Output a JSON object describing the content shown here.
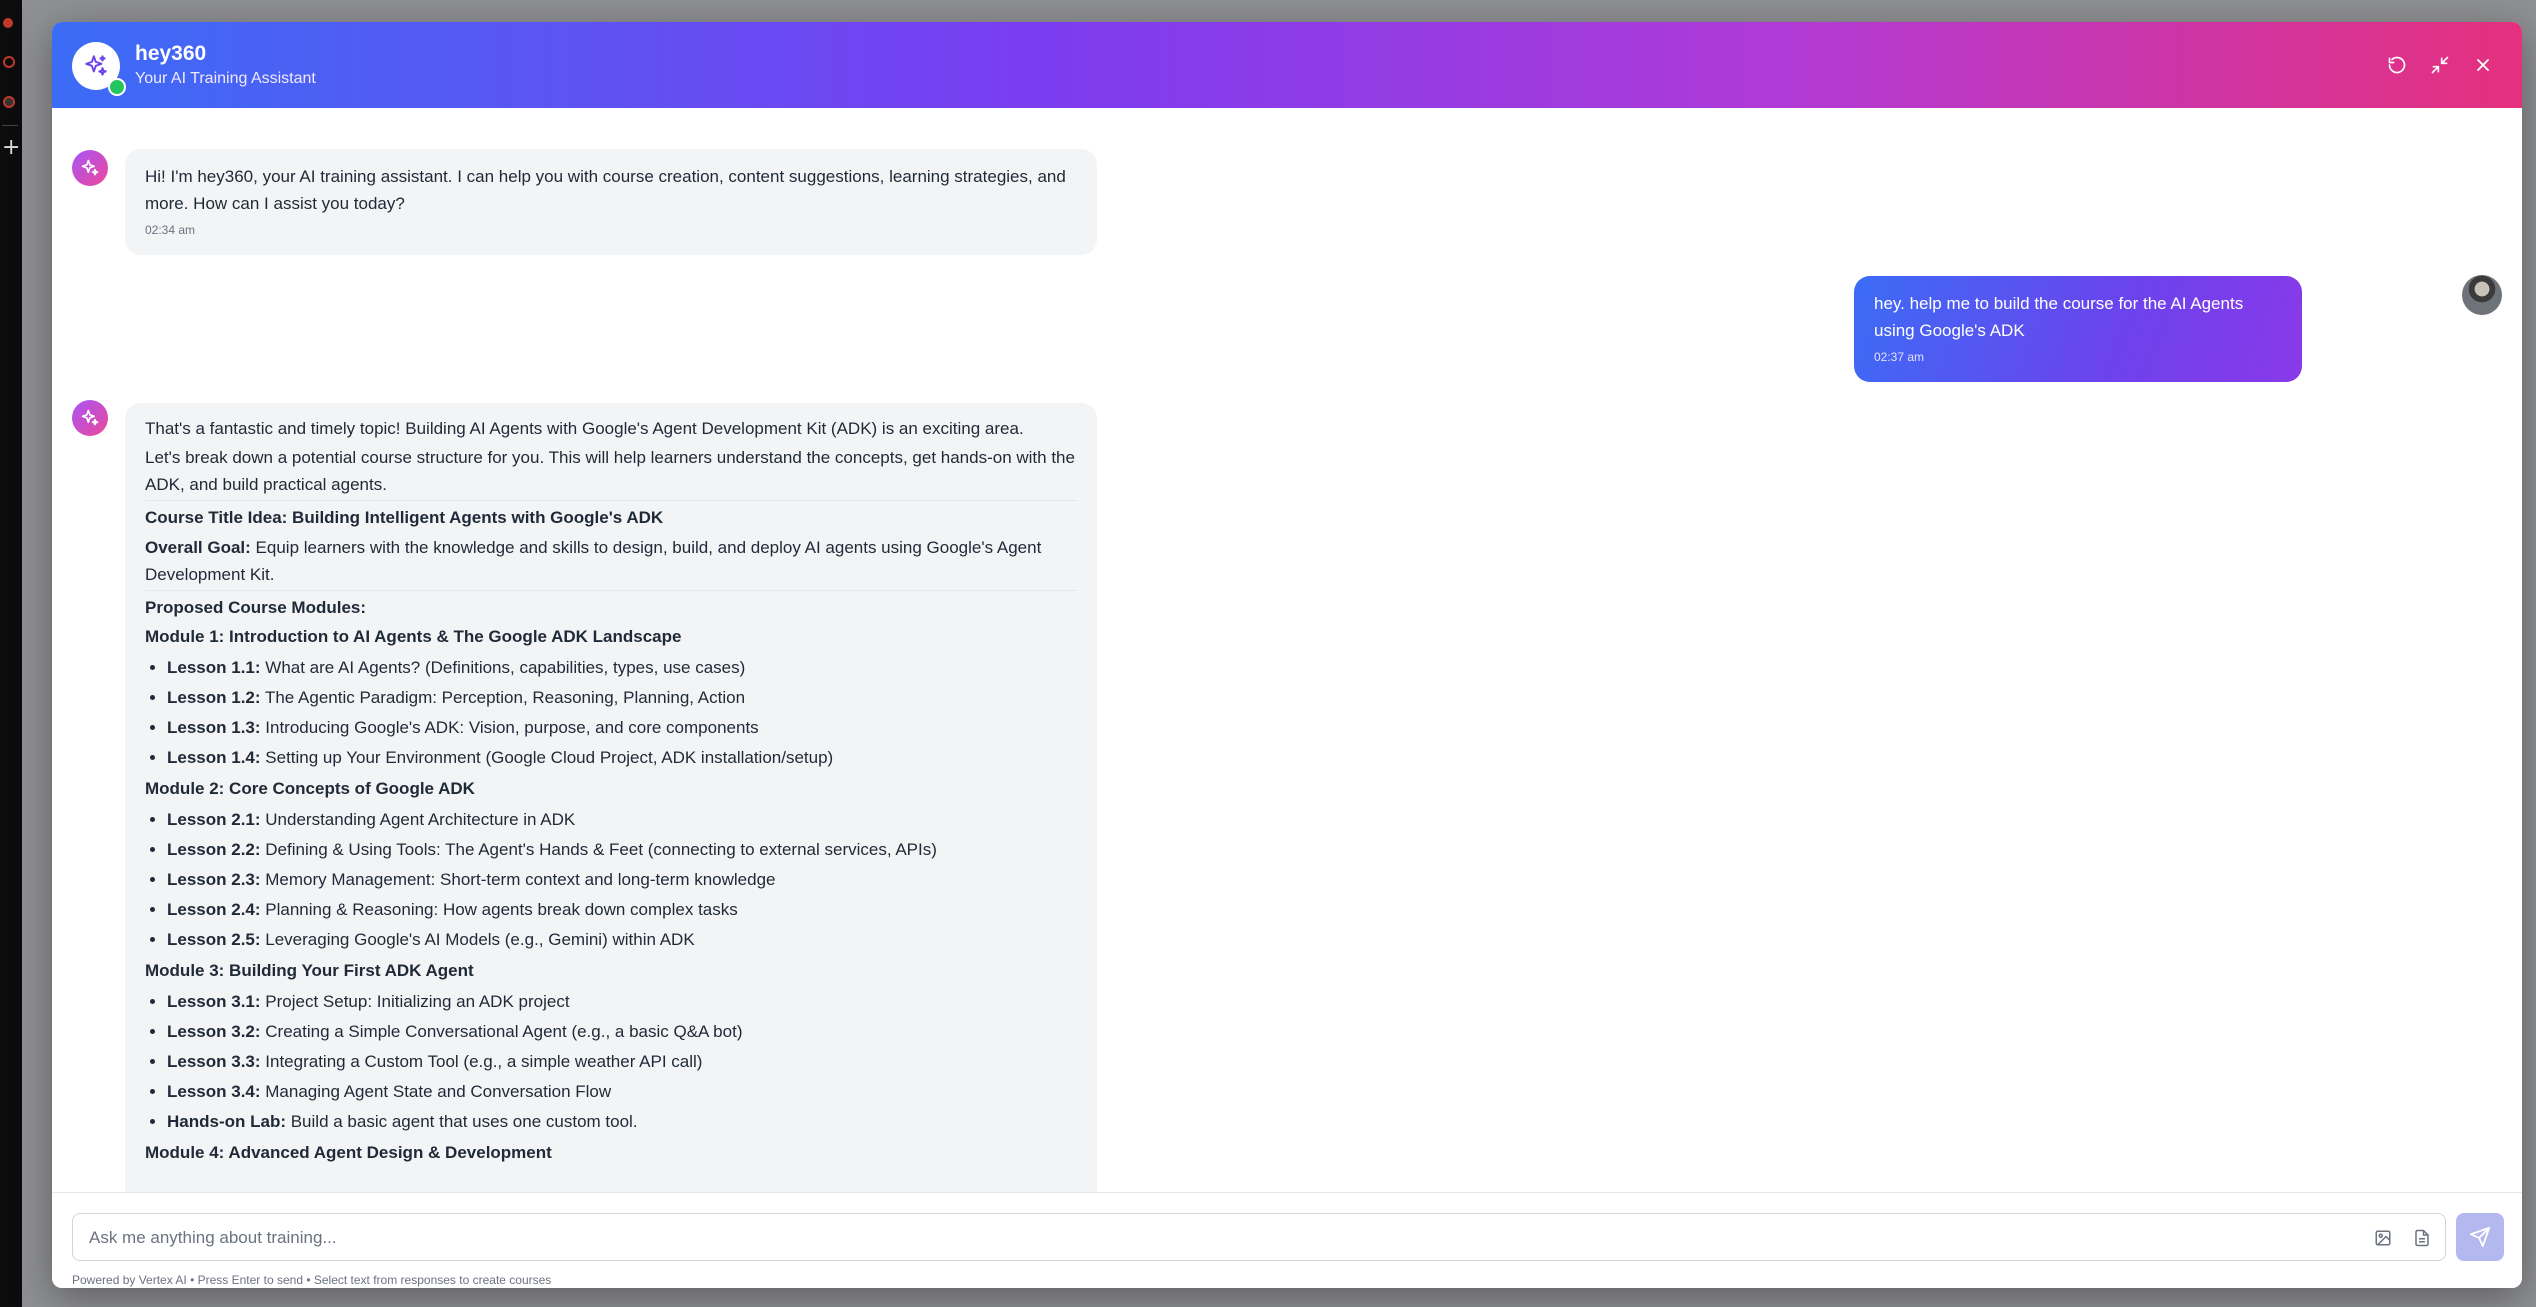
{
  "app": {
    "title": "hey360",
    "subtitle": "Your AI Training Assistant"
  },
  "colors": {
    "header_start": "#3b6cf6",
    "header_mid": "#7b3df0",
    "header_end": "#e5307d",
    "online": "#22c55e",
    "bot_bubble": "#f3f4f6"
  },
  "header_icons": [
    "refresh-icon",
    "minimize-icon",
    "close-icon"
  ],
  "messages": {
    "bot_greeting": {
      "text": "Hi! I'm hey360, your AI training assistant. I can help you with course creation, content suggestions, learning strategies, and more. How can I assist you today?",
      "time": "02:34 am"
    },
    "user_request": {
      "text": "hey. help me to build the course for the AI Agents using Google's ADK",
      "time": "02:37 am"
    },
    "bot_course": {
      "intro1": "That's a fantastic and timely topic! Building AI Agents with Google's Agent Development Kit (ADK) is an exciting area.",
      "intro2": "Let's break down a potential course structure for you. This will help learners understand the concepts, get hands-on with the ADK, and build practical agents.",
      "title_line": "Course Title Idea: Building Intelligent Agents with Google's ADK",
      "goal_label": "Overall Goal:",
      "goal_text": " Equip learners with the knowledge and skills to design, build, and deploy AI agents using Google's Agent Development Kit.",
      "modules_heading": "Proposed Course Modules:",
      "modules": [
        {
          "title": "Module 1: Introduction to AI Agents & The Google ADK Landscape",
          "lessons": [
            {
              "label": "Lesson 1.1:",
              "text": " What are AI Agents? (Definitions, capabilities, types, use cases)"
            },
            {
              "label": "Lesson 1.2:",
              "text": " The Agentic Paradigm: Perception, Reasoning, Planning, Action"
            },
            {
              "label": "Lesson 1.3:",
              "text": " Introducing Google's ADK: Vision, purpose, and core components"
            },
            {
              "label": "Lesson 1.4:",
              "text": " Setting up Your Environment (Google Cloud Project, ADK installation/setup)"
            }
          ]
        },
        {
          "title": "Module 2: Core Concepts of Google ADK",
          "lessons": [
            {
              "label": "Lesson 2.1:",
              "text": " Understanding Agent Architecture in ADK"
            },
            {
              "label": "Lesson 2.2:",
              "text": " Defining & Using Tools: The Agent's Hands & Feet (connecting to external services, APIs)"
            },
            {
              "label": "Lesson 2.3:",
              "text": " Memory Management: Short-term context and long-term knowledge"
            },
            {
              "label": "Lesson 2.4:",
              "text": " Planning & Reasoning: How agents break down complex tasks"
            },
            {
              "label": "Lesson 2.5:",
              "text": " Leveraging Google's AI Models (e.g., Gemini) within ADK"
            }
          ]
        },
        {
          "title": "Module 3: Building Your First ADK Agent",
          "lessons": [
            {
              "label": "Lesson 3.1:",
              "text": " Project Setup: Initializing an ADK project"
            },
            {
              "label": "Lesson 3.2:",
              "text": " Creating a Simple Conversational Agent (e.g., a basic Q&A bot)"
            },
            {
              "label": "Lesson 3.3:",
              "text": " Integrating a Custom Tool (e.g., a simple weather API call)"
            },
            {
              "label": "Lesson 3.4:",
              "text": " Managing Agent State and Conversation Flow"
            },
            {
              "label": "Hands-on Lab:",
              "text": " Build a basic agent that uses one custom tool."
            }
          ]
        }
      ],
      "module4_title": "Module 4: Advanced Agent Design & Development"
    }
  },
  "composer": {
    "placeholder": "Ask me anything about training...",
    "value": "",
    "powered_by": "Powered by Vertex AI • Press Enter to send • Select text from responses to create courses"
  }
}
